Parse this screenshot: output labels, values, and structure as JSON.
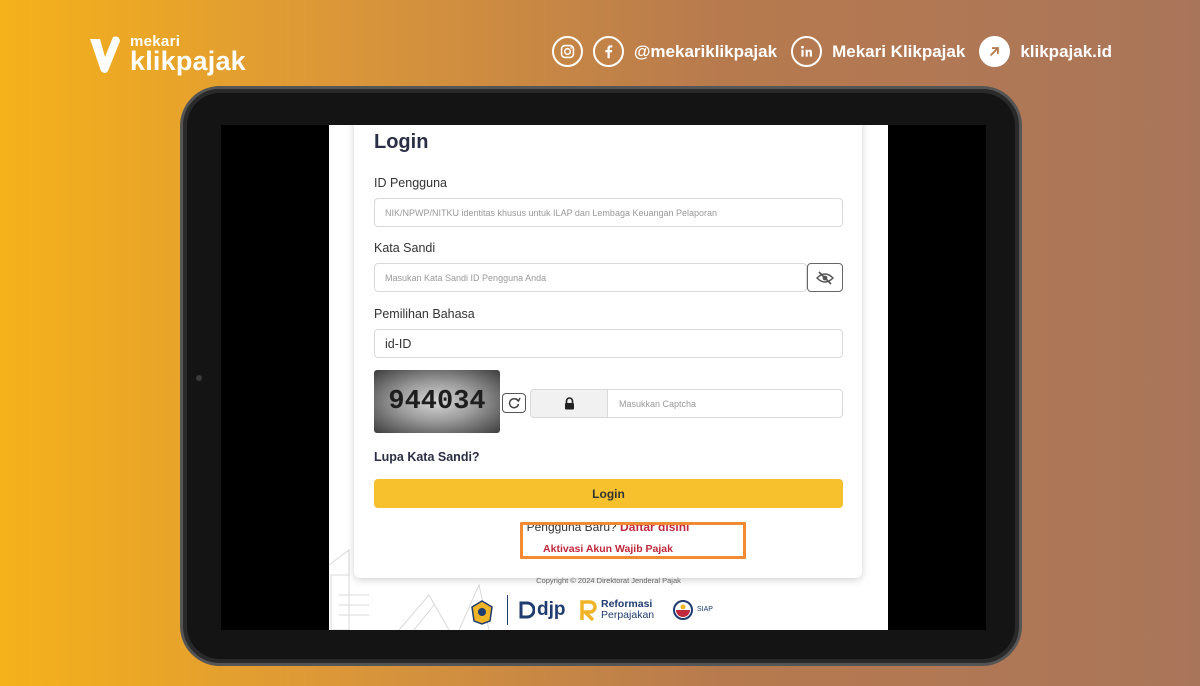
{
  "brand": {
    "small": "mekari",
    "big": "klikpajak"
  },
  "social": {
    "handle": "@mekariklikpajak",
    "linkedin": "Mekari Klikpajak",
    "website": "klikpajak.id"
  },
  "login": {
    "title": "Login",
    "user_label": "ID Pengguna",
    "user_placeholder": "NIK/NPWP/NITKU identitas khusus untuk ILAP dan Lembaga Keuangan Pelaporan",
    "pass_label": "Kata Sandi",
    "pass_placeholder": "Masukan Kata Sandi ID Pengguna Anda",
    "lang_label": "Pemilihan Bahasa",
    "lang_value": "id-ID",
    "captcha_text": "944034",
    "captcha_placeholder": "Masukkan Captcha",
    "forgot": "Lupa Kata Sandi?",
    "login_button": "Login",
    "new_user": "Pengguna Baru?",
    "register_link": "Daftar disini",
    "activate_link": "Aktivasi Akun Wajib Pajak"
  },
  "footer": {
    "copyright": "Copyright © 2024 Direktorat Jenderal Pajak",
    "djp": "djp",
    "reformasi_top": "Reformasi",
    "reformasi_bottom": "Perpajakan",
    "siap": "SIAP"
  },
  "colors": {
    "accent": "#f6c12c",
    "link": "#c0283c",
    "highlight": "#f28a34"
  }
}
